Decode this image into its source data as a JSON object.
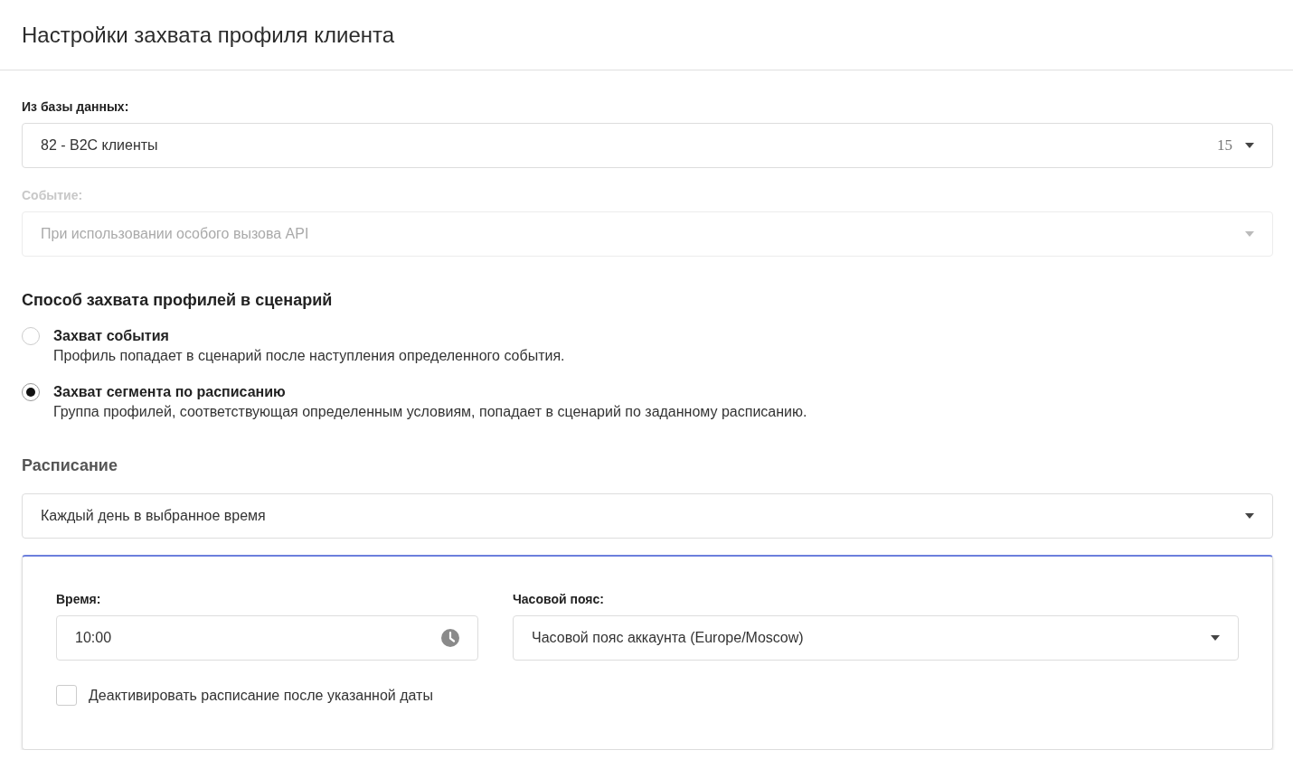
{
  "header": {
    "title": "Настройки захвата профиля клиента"
  },
  "fields": [
    {
      "label": "Из базы данных:",
      "value": "82 - B2C клиенты",
      "count": "15",
      "disabled": false
    },
    {
      "label": "Событие:",
      "value": "При использовании особого вызова API",
      "disabled": true
    }
  ],
  "capture": {
    "heading": "Способ захвата профилей в сценарий",
    "options": [
      {
        "title": "Захват события",
        "description": "Профиль попадает в сценарий после наступления определенного события.",
        "selected": false
      },
      {
        "title": "Захват сегмента по расписанию",
        "description": "Группа профилей, соответствующая определенным условиям, попадает в сценарий по заданному расписанию.",
        "selected": true
      }
    ]
  },
  "schedule": {
    "heading": "Расписание",
    "frequency": "Каждый день в выбранное время",
    "time": {
      "label": "Время:",
      "value": "10:00"
    },
    "timezone": {
      "label": "Часовой пояс:",
      "value": "Часовой пояс аккаунта (Europe/Moscow)"
    },
    "deactivate": {
      "label": "Деактивировать расписание после указанной даты",
      "checked": false
    }
  }
}
